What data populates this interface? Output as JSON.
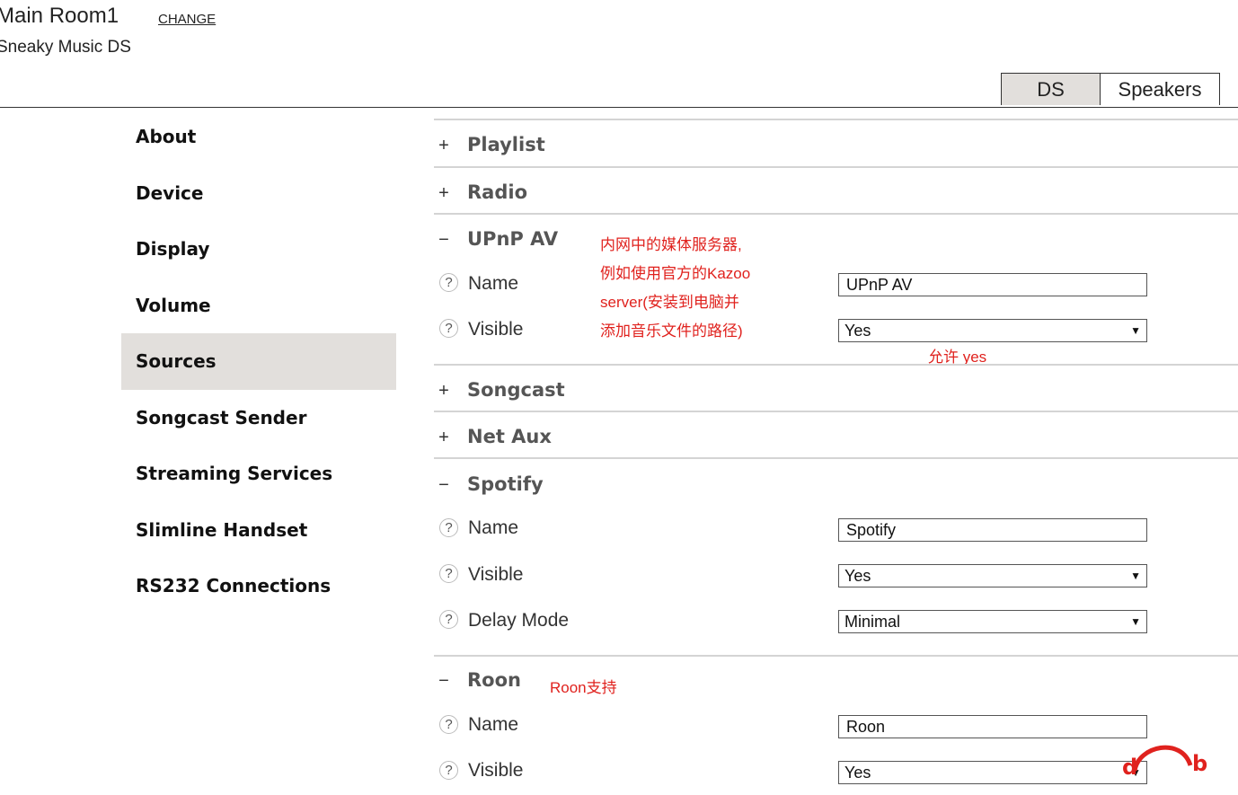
{
  "header": {
    "room_name": "Main Room1",
    "change_label": "CHANGE",
    "device_name": "Sneaky Music DS"
  },
  "tabs": [
    {
      "label": "DS",
      "active": true
    },
    {
      "label": "Speakers",
      "active": false
    }
  ],
  "sidebar": {
    "items": [
      {
        "label": "About"
      },
      {
        "label": "Device"
      },
      {
        "label": "Display"
      },
      {
        "label": "Volume"
      },
      {
        "label": "Sources",
        "active": true
      },
      {
        "label": "Songcast Sender"
      },
      {
        "label": "Streaming Services"
      },
      {
        "label": "Slimline Handset"
      },
      {
        "label": "RS232 Connections"
      }
    ]
  },
  "sections": {
    "playlist": {
      "toggle": "+",
      "title": "Playlist"
    },
    "radio": {
      "toggle": "+",
      "title": "Radio"
    },
    "upnp": {
      "toggle": "−",
      "title": "UPnP AV",
      "name_label": "Name",
      "name_value": "UPnP AV",
      "visible_label": "Visible",
      "visible_value": "Yes"
    },
    "songcast": {
      "toggle": "+",
      "title": "Songcast"
    },
    "netaux": {
      "toggle": "+",
      "title": "Net Aux"
    },
    "spotify": {
      "toggle": "−",
      "title": "Spotify",
      "name_label": "Name",
      "name_value": "Spotify",
      "visible_label": "Visible",
      "visible_value": "Yes",
      "delay_label": "Delay Mode",
      "delay_value": "Minimal"
    },
    "roon": {
      "toggle": "−",
      "title": "Roon",
      "name_label": "Name",
      "name_value": "Roon",
      "visible_label": "Visible",
      "visible_value": "Yes"
    }
  },
  "help_glyph": "?",
  "select_arrow": "▼",
  "annotations": {
    "upnp_line1": "内网中的媒体服务器,",
    "upnp_line2": "例如使用官方的Kazoo",
    "upnp_line3": "server(安装到电脑并",
    "upnp_line4": "添加音乐文件的路径)",
    "allow_yes": "允许 yes",
    "roon_support": "Roon支持"
  },
  "colors": {
    "accent_red": "#e0221e",
    "active_bg": "#e2dfdc"
  },
  "icons": {
    "help": "help-circle-icon",
    "dropdown": "chevron-down-icon",
    "watermark": "headphone-logo"
  }
}
